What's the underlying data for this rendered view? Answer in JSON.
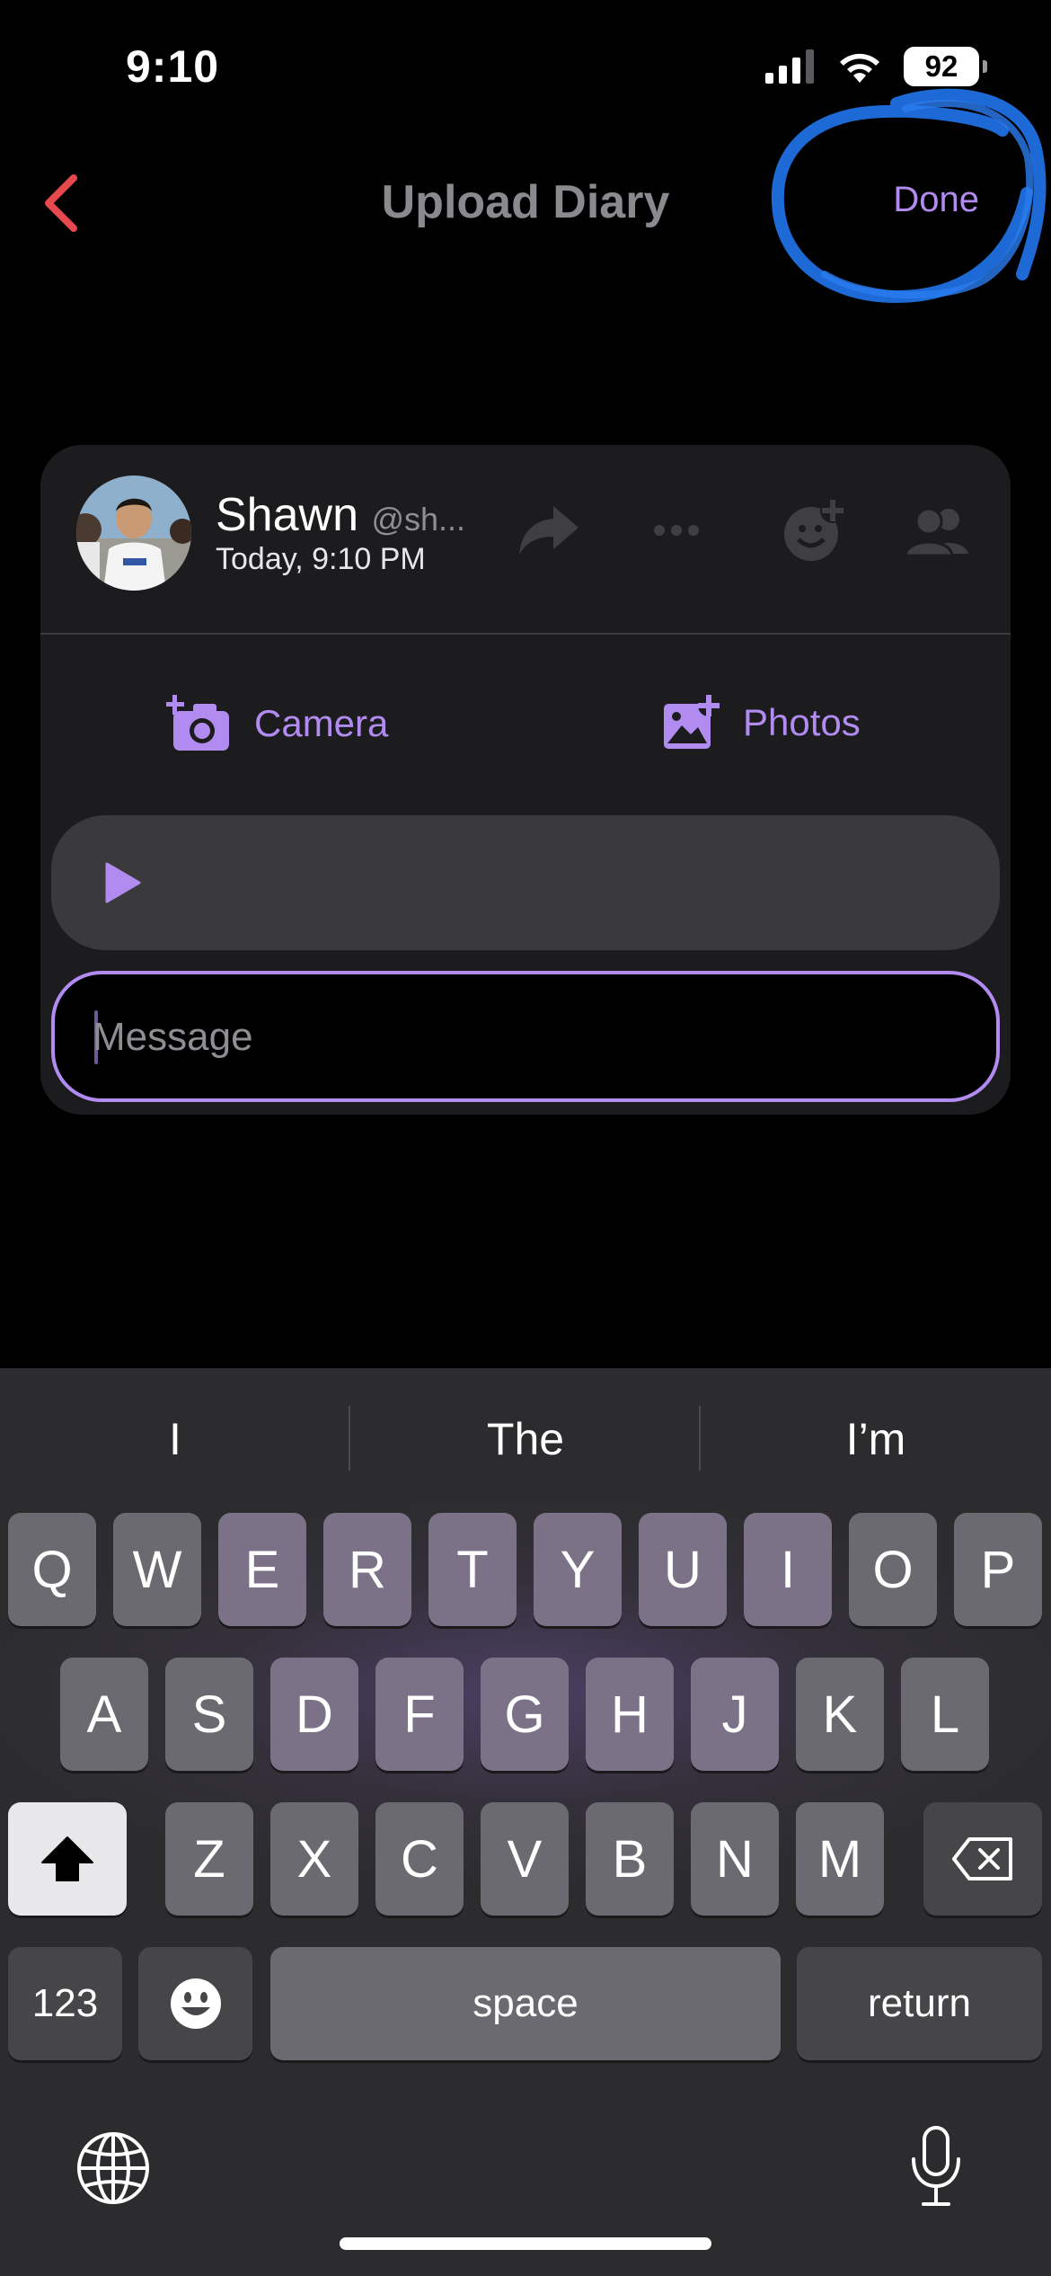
{
  "status_bar": {
    "time": "9:10",
    "battery": "92"
  },
  "nav": {
    "title": "Upload Diary",
    "done_label": "Done"
  },
  "post": {
    "user_name": "Shawn",
    "user_handle": "@sh...",
    "timestamp": "Today, 9:10 PM",
    "camera_label": "Camera",
    "photos_label": "Photos",
    "message_placeholder": "Message"
  },
  "keyboard": {
    "suggestions": [
      "I",
      "The",
      "I’m"
    ],
    "row1": [
      "Q",
      "W",
      "E",
      "R",
      "T",
      "Y",
      "U",
      "I",
      "O",
      "P"
    ],
    "row2": [
      "A",
      "S",
      "D",
      "F",
      "G",
      "H",
      "J",
      "K",
      "L"
    ],
    "row3": [
      "Z",
      "X",
      "C",
      "V",
      "B",
      "N",
      "M"
    ],
    "numbers_label": "123",
    "space_label": "space",
    "return_label": "return"
  },
  "colors": {
    "accent": "#b18bf0",
    "back_arrow": "#e5484d",
    "annotation_scribble": "#1f6fe0"
  }
}
